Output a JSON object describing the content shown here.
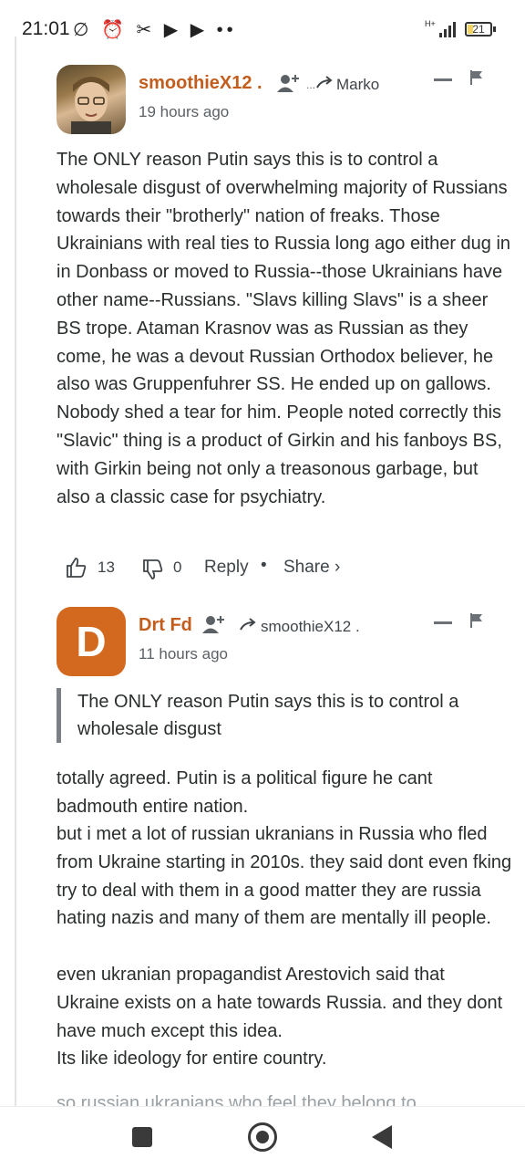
{
  "status_bar": {
    "time": "21:01",
    "icons_text": "∅ ⏰ ✂ ▶ ▶ ••",
    "network": "H+",
    "battery": "21"
  },
  "comments": [
    {
      "author": "smoothieX12 .",
      "reply_to": "Marko",
      "timestamp": "19 hours ago",
      "body": "The ONLY reason Putin says this is to control a wholesale disgust of overwhelming majority of Russians towards their \"brotherly\" nation of freaks. Those Ukrainians with real ties to Russia long ago either dug in in Donbass or moved to Russia--those Ukrainians have other name--Russians. \"Slavs killing Slavs\" is a sheer BS trope. Ataman Krasnov was as Russian as they come, he was a devout Russian Orthodox believer, he also was Gruppenfuhrer SS. He ended up on gallows. Nobody shed a tear for him. People noted correctly this \"Slavic\" thing is a product of Girkin and his fanboys BS, with Girkin being not only a treasonous garbage, but also a classic case for psychiatry.",
      "upvotes": "13",
      "downvotes": "0",
      "reply_label": "Reply",
      "share_label": "Share ›"
    },
    {
      "author": "Drt Fd",
      "avatar_letter": "D",
      "reply_to": "smoothieX12 .",
      "timestamp": "11 hours ago",
      "quote": "The ONLY reason Putin says this is to control a wholesale disgust",
      "body_lines": [
        "totally agreed. Putin is a political figure he cant badmouth entire nation.",
        "but i met a lot of russian ukranians in Russia who fled from Ukraine starting in 2010s. they said dont even fking try to deal with them in a good matter they are russia hating nazis and many of them are mentally ill people.",
        "even ukranian propagandist Arestovich said that Ukraine exists on a hate towards Russia. and they dont have much except this idea.",
        "Its like ideology for entire country."
      ],
      "cutoff_line": "so russian ukranians who feel they belong to"
    }
  ],
  "colors": {
    "author": "#c35d1d",
    "avatar_d": "#d2691e"
  }
}
